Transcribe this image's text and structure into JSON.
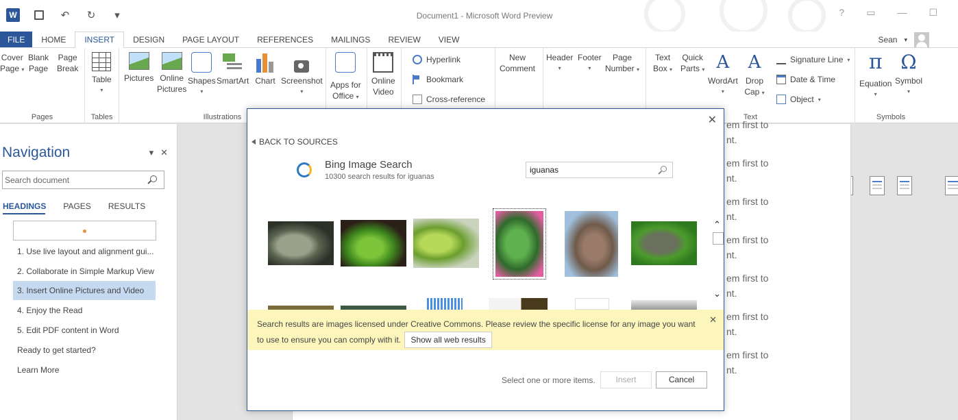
{
  "window": {
    "title": "Document1 - Microsoft Word Preview",
    "help": "?",
    "user": "Sean",
    "user_arrow": "▾"
  },
  "qat": {
    "undo": "↶",
    "redo": "↻",
    "customize": "▾",
    "logo": "W"
  },
  "tabs": [
    "FILE",
    "HOME",
    "INSERT",
    "DESIGN",
    "PAGE LAYOUT",
    "REFERENCES",
    "MAILINGS",
    "REVIEW",
    "VIEW"
  ],
  "ribbon": {
    "pages": {
      "label": "Pages",
      "cover": "Cover",
      "cover2": "Page",
      "blank": "Blank",
      "blank2": "Page",
      "break": "Page",
      "break2": "Break"
    },
    "tables": {
      "label": "Tables",
      "table": "Table"
    },
    "illustrations": {
      "label": "Illustrations",
      "pictures": "Pictures",
      "online": "Online",
      "online2": "Pictures",
      "shapes": "Shapes",
      "smartart": "SmartArt",
      "chart": "Chart",
      "screenshot": "Screenshot"
    },
    "apps": {
      "apps": "Apps for",
      "apps2": "Office"
    },
    "media": {
      "video": "Online",
      "video2": "Video"
    },
    "links": {
      "hyperlink": "Hyperlink",
      "bookmark": "Bookmark",
      "xref": "Cross-reference"
    },
    "comments": {
      "new": "New",
      "new2": "Comment"
    },
    "header_footer": {
      "header": "Header",
      "footer": "Footer",
      "page_number": "Page",
      "page_number2": "Number"
    },
    "text": {
      "label": "Text",
      "textbox": "Text",
      "textbox2": "Box",
      "quickparts": "Quick",
      "quickparts2": "Parts",
      "wordart": "WordArt",
      "dropcap": "Drop",
      "dropcap2": "Cap",
      "signature": "Signature Line",
      "datetime": "Date & Time",
      "object": "Object"
    },
    "symbols": {
      "label": "Symbols",
      "equation": "Equation",
      "symbol": "Symbol",
      "pi": "π",
      "omega": "Ω"
    }
  },
  "navigation": {
    "title": "Navigation",
    "search_placeholder": "Search document",
    "tabs": [
      "HEADINGS",
      "PAGES",
      "RESULTS"
    ],
    "items": [
      "1. Use live layout and alignment gui...",
      "2. Collaborate in Simple Markup View",
      "3. Insert Online Pictures and Video",
      "4. Enjoy the Read",
      "5. Edit PDF content in Word",
      "Ready to get started?",
      "Learn More"
    ],
    "selected_index": 2
  },
  "document": {
    "lines": [
      "em first to",
      "nt.",
      "em first to",
      "nt.",
      "em first to",
      "nt.",
      "em first to",
      "nt.",
      "em first to",
      "nt.",
      "em first to",
      "nt.",
      "em first to",
      "nt."
    ]
  },
  "dialog": {
    "back": "BACK TO SOURCES",
    "source_title": "Bing Image Search",
    "results_text": "10300 search results for iguanas",
    "search_value": "iguanas",
    "notice": "Search results are images licensed under Creative Commons. Please review the specific license for any image you want to use to ensure you can comply with it.",
    "show_web": "Show all web results",
    "status": "Select one or more items.",
    "insert": "Insert",
    "cancel": "Cancel",
    "close": "✕",
    "notice_close": "✕",
    "scroll_up": "⌃",
    "scroll_down": "⌄"
  },
  "colors": {
    "accent": "#2b579a",
    "notice_bg": "#fcf6bd",
    "selected_nav": "#c5d9f1"
  }
}
